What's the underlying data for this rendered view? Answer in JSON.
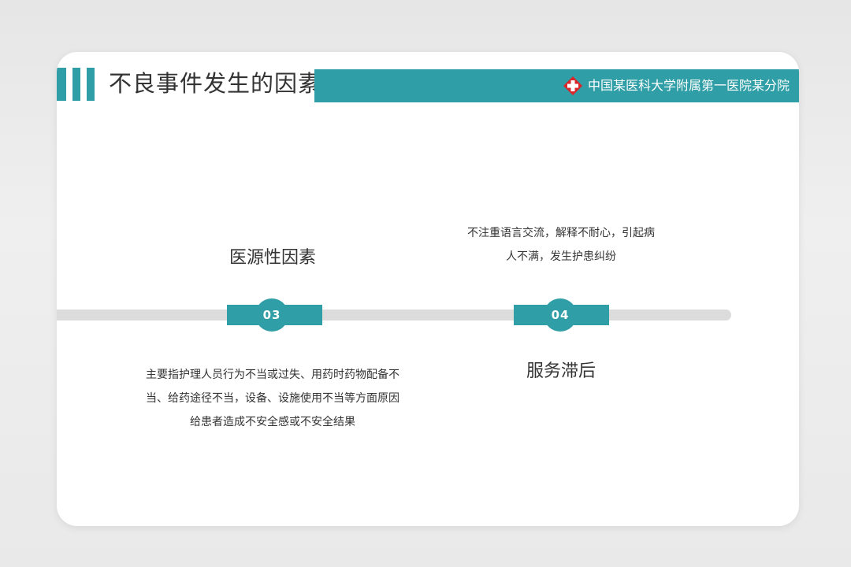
{
  "slide": {
    "title": "不良事件发生的因素",
    "organization": "中国某医科大学附属第一医院某分院",
    "logo_icon": "red-cross-icon"
  },
  "timeline": {
    "items": [
      {
        "number": "03",
        "heading": "医源性因素",
        "description_lines": [
          "主要指护理人员行为不当或过失、用药时药物配备不",
          "当、给药途径不当，设备、设施使用不当等方面原因",
          "给患者造成不安全感或不安全结果"
        ]
      },
      {
        "number": "04",
        "heading": "服务滞后",
        "description_lines": [
          "不注重语言交流，解释不耐心，引起病",
          "人不满，发生护患纠纷"
        ]
      }
    ]
  },
  "colors": {
    "accent": "#2f9ea6",
    "track": "#dcdcdc",
    "text": "#333333",
    "logo_red": "#d9262b"
  }
}
